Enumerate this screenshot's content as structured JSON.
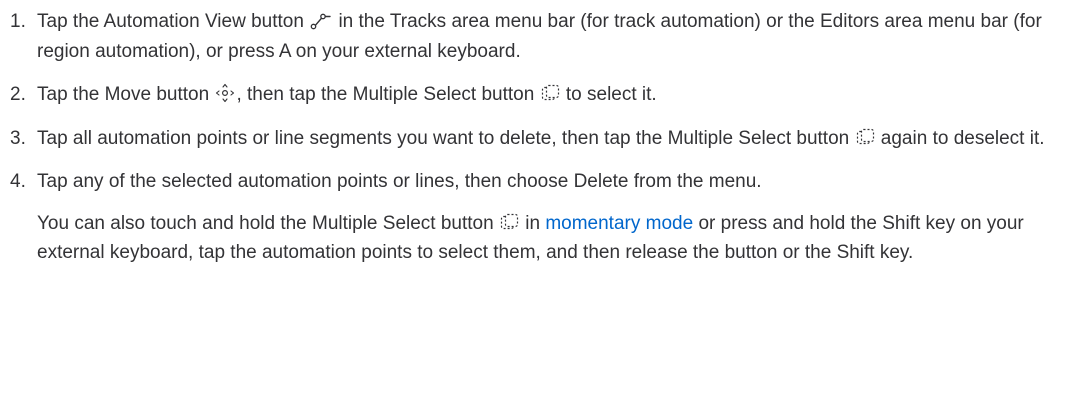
{
  "steps": [
    {
      "number": "1.",
      "parts": [
        "Tap the Automation View button",
        "in the Tracks area menu bar (for track automation) or the Editors area menu bar (for region automation), or press A on your external keyboard."
      ]
    },
    {
      "number": "2.",
      "parts": [
        "Tap the Move button",
        ", then tap the Multiple Select button",
        "to select it."
      ]
    },
    {
      "number": "3.",
      "parts": [
        "Tap all automation points or line segments you want to delete, then tap the Multiple Select button",
        "again to deselect it."
      ]
    },
    {
      "number": "4.",
      "parts": [
        "Tap any of the selected automation points or lines, then choose Delete from the menu."
      ]
    }
  ],
  "note": {
    "before_icon": "You can also touch and hold the Multiple Select button",
    "before_link": "in",
    "link": "momentary mode",
    "after_link": "or press and hold the Shift key on your external keyboard, tap the automation points to select them, and then release the button or the Shift key."
  },
  "icons": {
    "automation_view": "automation-view-icon",
    "move": "move-icon",
    "multiple_select": "multiple-select-icon"
  },
  "colors": {
    "text": "#333336",
    "link": "#0066cc"
  }
}
